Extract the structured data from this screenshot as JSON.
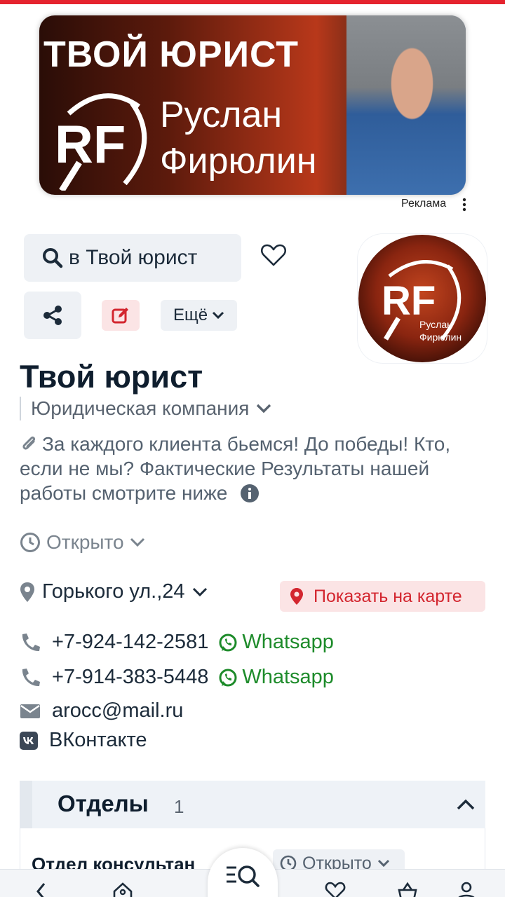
{
  "banner": {
    "headline": "ТВОЙ ЮРИСТ",
    "name_line1": "Руслан",
    "name_line2": "Фирюлин",
    "logo_text": "RF",
    "ad_label": "Реклама"
  },
  "actions": {
    "search_label": "в Твой юрист",
    "more_label": "Ещё"
  },
  "company": {
    "logo_text": "RF",
    "logo_caption_1": "Руслан",
    "logo_caption_2": "Фирюлин",
    "title": "Твой юрист",
    "category": "Юридическая компания",
    "description": "За каждого клиента бьемся! До победы! Кто, если не мы? Фактические Результаты нашей работы смотрите ниже",
    "status": "Открыто",
    "address": "Горького ул.,24",
    "map_button": "Показать на карте"
  },
  "contacts": {
    "phone1": "+7-924-142-2581",
    "phone2": "+7-914-383-5448",
    "whatsapp_label": "Whatsapp",
    "email": "arocc@mail.ru",
    "vk": "ВКонтакте"
  },
  "departments": {
    "title": "Отделы",
    "count": "1",
    "item_name": "Отдел консультан",
    "item_status": "Открыто"
  },
  "colors": {
    "accent_red": "#e5232e",
    "whatsapp_green": "#1d8b2a",
    "chip_bg": "#eef1f5"
  }
}
